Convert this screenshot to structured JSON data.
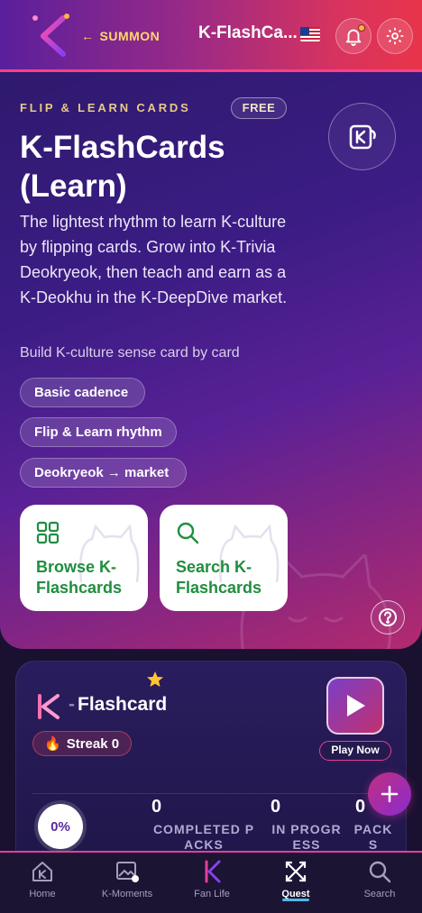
{
  "header": {
    "back_label": "SUMMON",
    "title": "K-FlashCa...",
    "flag_name": "us-flag",
    "notification_dot_color": "#ffb73b"
  },
  "hero": {
    "eyebrow": "FLIP & LEARN CARDS",
    "badge": "FREE",
    "title": "K-FlashCards (Learn)",
    "description": "The lightest rhythm to learn K-culture by flipping cards. Grow into K-Trivia Deokryeok, then teach and earn as a K-Deokhu in the K-DeepDive market.",
    "subtitle": "Build K-culture sense card by card",
    "chips": [
      "Basic cadence",
      "Flip & Learn rhythm",
      "Deokryeok → market"
    ],
    "actions": [
      {
        "label": "Browse K-Flashcards",
        "icon": "grid-icon"
      },
      {
        "label": "Search K-Flashcards",
        "icon": "search-icon"
      }
    ]
  },
  "quest": {
    "title_dash": "-",
    "title": "Flashcard",
    "streak_label": "Streak 0",
    "play_label": "Play Now",
    "progress_percent": "0%",
    "stats": [
      {
        "value": "0",
        "label": "COMPLETED PACKS"
      },
      {
        "value": "0",
        "label": "IN PROGRESS"
      },
      {
        "value": "0",
        "label": "PACKS"
      }
    ]
  },
  "nav": {
    "items": [
      {
        "label": "Home",
        "icon": "home-icon"
      },
      {
        "label": "K-Moments",
        "icon": "photo-icon"
      },
      {
        "label": "Fan Life",
        "icon": "k-logo-icon"
      },
      {
        "label": "Quest",
        "icon": "quest-icon"
      },
      {
        "label": "Search",
        "icon": "search-icon"
      }
    ],
    "active": "Quest"
  },
  "colors": {
    "accent_pink": "#e33ea0",
    "eyebrow_gold": "#e9c985",
    "action_green": "#1f8e3e",
    "nav_active_bar": "#4fb7e8"
  }
}
